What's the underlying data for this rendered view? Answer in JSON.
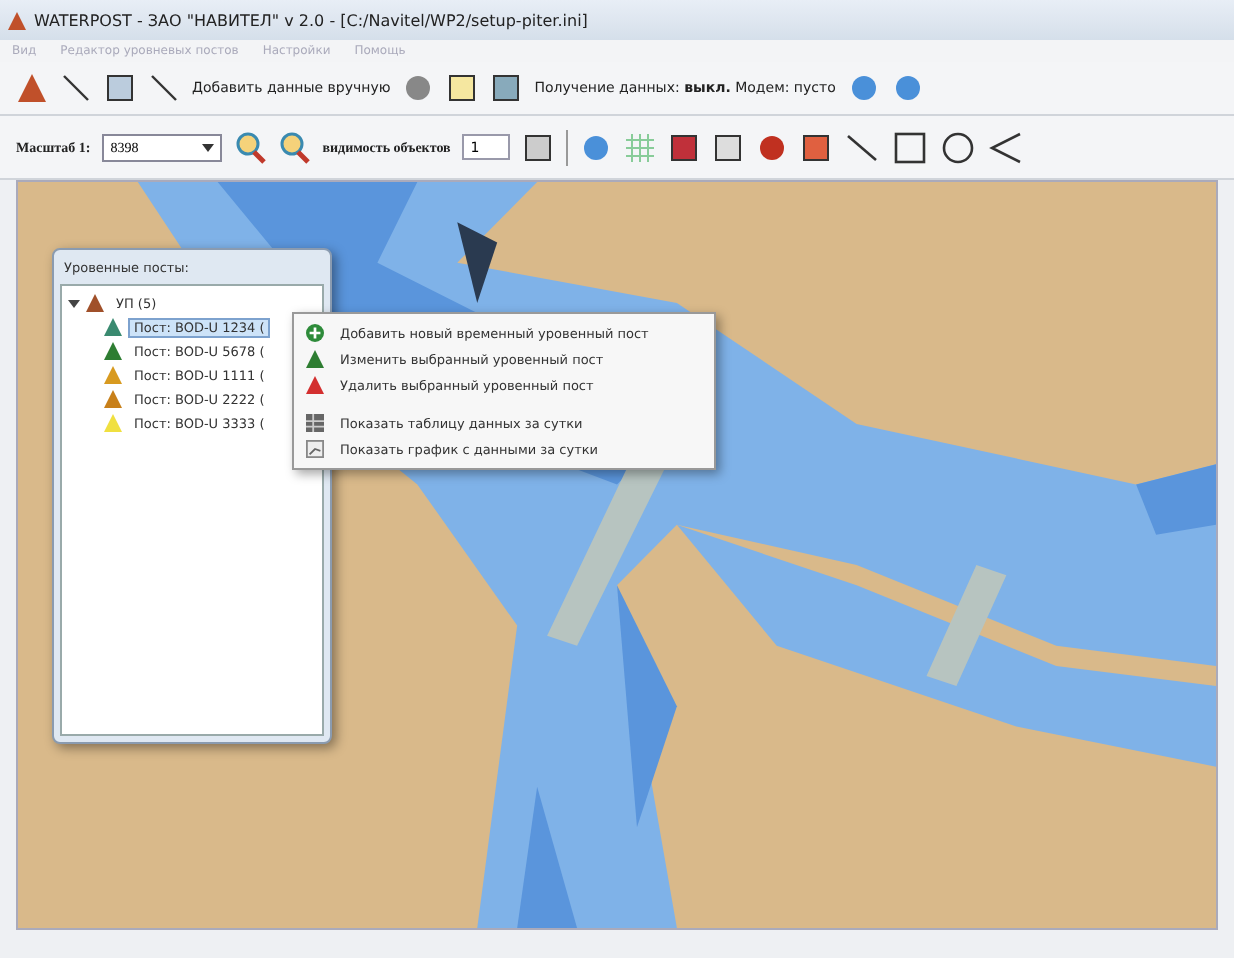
{
  "window": {
    "title": "WATERPOST - ЗАО \"НАВИТЕЛ\" v 2.0 - [C:/Navitel/WP2/setup-piter.ini]"
  },
  "menu": [
    "Вид",
    "Редактор уровневых постов",
    "Настройки",
    "Помощь"
  ],
  "toolbar": {
    "add_manual": "Добавить данные вручную",
    "receive": "Получение данных: **выкл.** Модем: пусто"
  },
  "scale": {
    "label": "Масштаб 1:",
    "value": "8398",
    "visibility_label": "видимость объектов",
    "visibility_value": "1"
  },
  "map": {
    "kind": "picture"
  },
  "posts_panel": {
    "title": "Уровенные посты:",
    "root": {
      "label": "УП (5)",
      "expanded": true,
      "children": [
        {
          "label": "Пост: BOD-U 1234 (",
          "color": "#3a8a70",
          "selected": true
        },
        {
          "label": "Пост: BOD-U 5678 (",
          "color": "#2e7d32",
          "selected": false
        },
        {
          "label": "Пост: BOD-U 1111 (",
          "color": "#d89a20",
          "selected": false
        },
        {
          "label": "Пост: BOD-U 2222 (",
          "color": "#c8801a",
          "selected": false
        },
        {
          "label": "Пост: BOD-U 3333 (",
          "color": "#f0e040",
          "selected": false
        }
      ]
    }
  },
  "context_menu": [
    {
      "kind": "add",
      "label": "Добавить новый временный уровенный пост"
    },
    {
      "kind": "edit",
      "label": "Изменить выбранный уровенный пост"
    },
    {
      "kind": "delete",
      "label": "Удалить выбранный уровенный пост"
    },
    {
      "kind": "table",
      "label": "Показать таблицу данных за сутки"
    },
    {
      "kind": "chart",
      "label": "Показать график с данными за сутки"
    }
  ]
}
